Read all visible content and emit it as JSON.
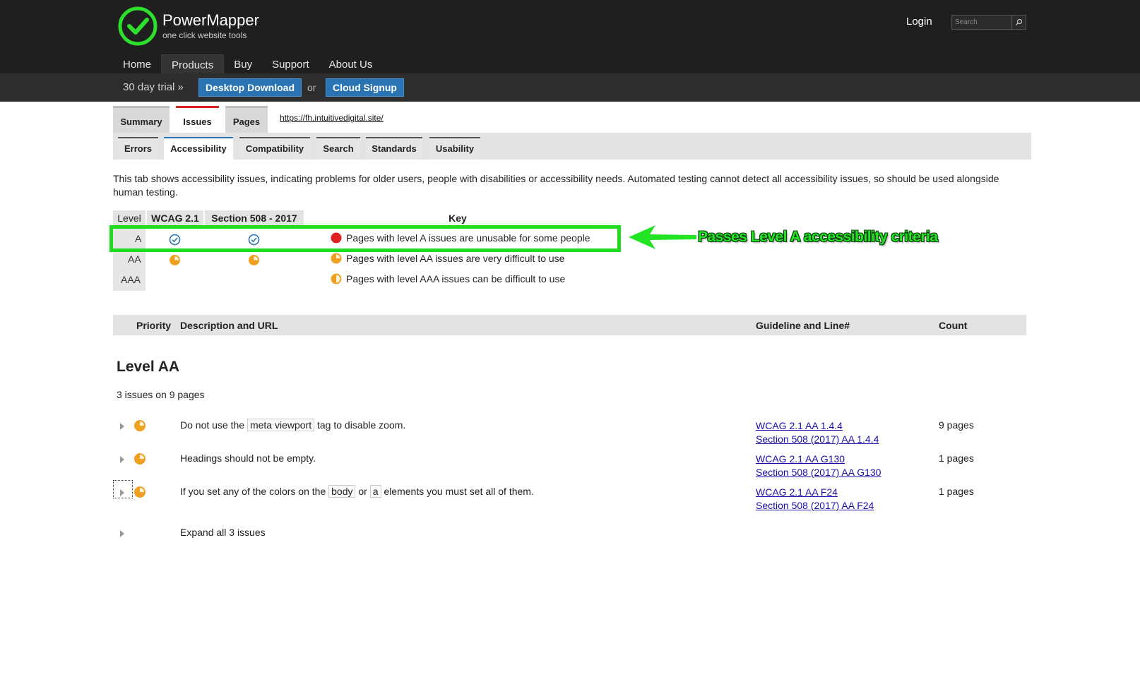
{
  "header": {
    "brand_name": "PowerMapper",
    "brand_tagline": "one click website tools",
    "login_label": "Login",
    "search_placeholder": "Search",
    "nav": [
      "Home",
      "Products",
      "Buy",
      "Support",
      "About Us"
    ],
    "active_nav": "Products",
    "trial_text": "30 day trial »",
    "desktop_download_label": "Desktop Download",
    "or_text": "or",
    "cloud_signup_label": "Cloud Signup"
  },
  "tabs": {
    "primary": [
      "Summary",
      "Issues",
      "Pages"
    ],
    "active_primary": "Issues",
    "site_url": "https://fh.intuitivedigital.site/",
    "secondary": [
      "Errors",
      "Accessibility",
      "Compatibility",
      "Search",
      "Standards",
      "Usability"
    ],
    "active_secondary": "Accessibility"
  },
  "intro_text": "This tab shows accessibility issues, indicating problems for older users, people with disabilities or accessibility needs. Automated testing cannot detect all accessibility issues, so should be used alongside human testing.",
  "level_table": {
    "headers": {
      "level": "Level",
      "wcag": "WCAG 2.1",
      "section508": "Section 508 - 2017",
      "key": "Key"
    },
    "rows": [
      {
        "level": "A",
        "wcag_icon": "check-icon",
        "s508_icon": "check-icon",
        "key_icon": "red-dot-icon",
        "key_text": "Pages with level A issues are unusable for some people"
      },
      {
        "level": "AA",
        "wcag_icon": "pie-three-quarter-icon",
        "s508_icon": "pie-three-quarter-icon",
        "key_icon": "pie-three-quarter-icon",
        "key_text": "Pages with level AA issues are very difficult to use"
      },
      {
        "level": "AAA",
        "key_icon": "pie-half-icon",
        "key_text": "Pages with level AAA issues can be difficult to use"
      }
    ]
  },
  "callout_text": "Passes Level A accessibility criteria",
  "issues_table": {
    "headers": {
      "priority": "Priority",
      "description": "Description and URL",
      "guideline": "Guideline and Line#",
      "count": "Count"
    },
    "level_title": "Level AA",
    "summary": "3 issues on 9 pages",
    "issues": [
      {
        "desc_before": "Do not use the",
        "code1": "meta viewport",
        "desc_after": "tag to disable zoom.",
        "guideline1": "WCAG 2.1 AA 1.4.4",
        "guideline2": "Section 508 (2017) AA 1.4.4",
        "count": "9 pages"
      },
      {
        "desc_before": "Headings should not be empty.",
        "guideline1": "WCAG 2.1 AA G130",
        "guideline2": "Section 508 (2017) AA G130",
        "count": "1 pages"
      },
      {
        "desc_before": "If you set any of the colors on the",
        "code1": "body",
        "desc_mid": "or",
        "code2": "a",
        "desc_after": "elements you must set all of them.",
        "guideline1": "WCAG 2.1 AA F24",
        "guideline2": "Section 508 (2017) AA F24",
        "count": "1 pages"
      }
    ],
    "expand_all_label": "Expand all 3 issues"
  },
  "colors": {
    "header_bg": "#1f1f1f",
    "accent_blue": "#2a74b3",
    "active_tab_red": "#d82020",
    "callout_green": "#1fdc1f",
    "issue_orange": "#f0a020",
    "error_red": "#e02020"
  }
}
